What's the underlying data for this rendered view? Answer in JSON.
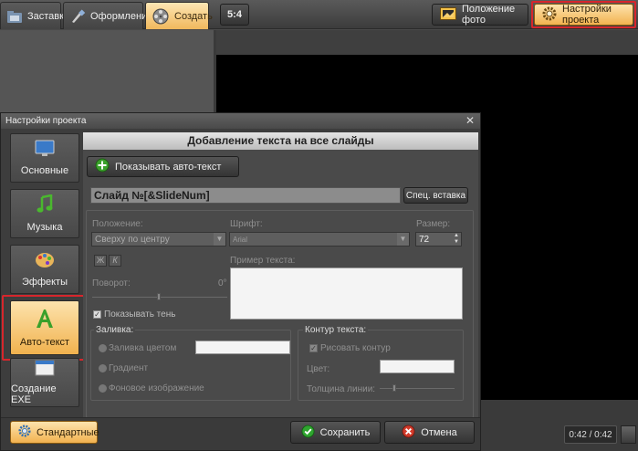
{
  "top_tabs": [
    {
      "label": "Заставки",
      "icon": "film-folder-icon"
    },
    {
      "label": "Оформление",
      "icon": "brush-icon"
    },
    {
      "label": "Создать",
      "icon": "film-reel-icon"
    }
  ],
  "aspect_button": "5:4",
  "photo_position_button": "Положение фото",
  "project_settings_button": "Настройки проекта",
  "dialog": {
    "title": "Настройки проекта",
    "sidebar": [
      {
        "label": "Основные",
        "icon": "monitor-icon"
      },
      {
        "label": "Музыка",
        "icon": "music-note-icon"
      },
      {
        "label": "Эффекты",
        "icon": "palette-icon"
      },
      {
        "label": "Авто-текст",
        "icon": "letter-a-icon"
      },
      {
        "label": "Создание EXE",
        "icon": "window-icon"
      }
    ],
    "pane_header": "Добавление текста на все слайды",
    "show_autotext_button": "Показывать авто-текст",
    "text_value": "Слайд №[&SlideNum]",
    "special_insert_button": "Спец. вставка",
    "position_label": "Положение:",
    "position_value": "Сверху по центру",
    "font_label": "Шрифт:",
    "font_value": "Arial",
    "size_label": "Размер:",
    "size_value": "72",
    "bold_label": "Ж",
    "italic_label": "К",
    "rotation_label": "Поворот:",
    "rotation_value": "0°",
    "sample_label": "Пример текста:",
    "show_shadow_label": "Показывать тень",
    "fill_group_label": "Заливка:",
    "fill_color_label": "Заливка цветом",
    "gradient_label": "Градиент",
    "bg_image_label": "Фоновое изображение",
    "outline_group_label": "Контур текста:",
    "draw_outline_label": "Рисовать контур",
    "color_label": "Цвет:",
    "line_width_label": "Толщина линии:"
  },
  "standard_button": "Стандартные",
  "save_button": "Сохранить",
  "cancel_button": "Отмена",
  "time_display": "0:42 / 0:42",
  "colors": {
    "accent_orange": "#f2b250",
    "highlight_red": "#d7262c",
    "save_green": "#2fa52f",
    "cancel_red": "#d23b2b"
  }
}
